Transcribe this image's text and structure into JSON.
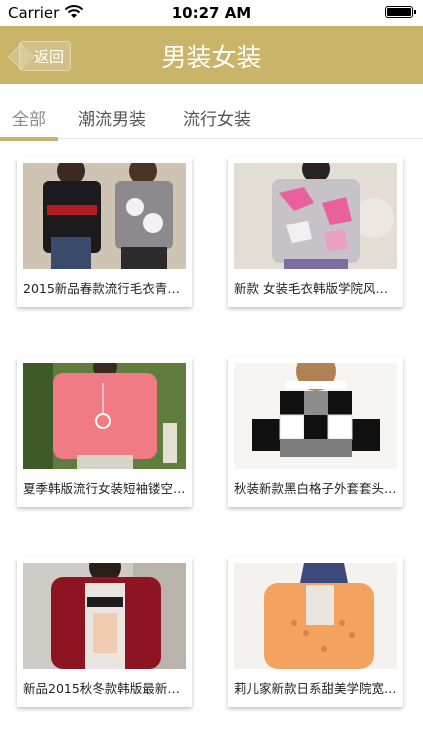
{
  "status_bar": {
    "carrier": "Carrier",
    "time": "10:27 AM"
  },
  "nav": {
    "back_label": "返回",
    "title": "男装女装"
  },
  "tabs": [
    {
      "label": "全部",
      "active": true
    },
    {
      "label": "潮流男装",
      "active": false
    },
    {
      "label": "流行女装",
      "active": false
    }
  ],
  "products": [
    {
      "caption": "2015新品春款流行毛衣青年…"
    },
    {
      "caption": "新款 女装毛衣韩版学院风流…"
    },
    {
      "caption": "夏季韩版流行女装短袖镂空…"
    },
    {
      "caption": "秋装新款黑白格子外套套头…"
    },
    {
      "caption": "新品2015秋冬款韩版最新流…"
    },
    {
      "caption": "莉儿家新款日系甜美学院宽…"
    }
  ],
  "colors": {
    "accent": "#c9b469"
  }
}
